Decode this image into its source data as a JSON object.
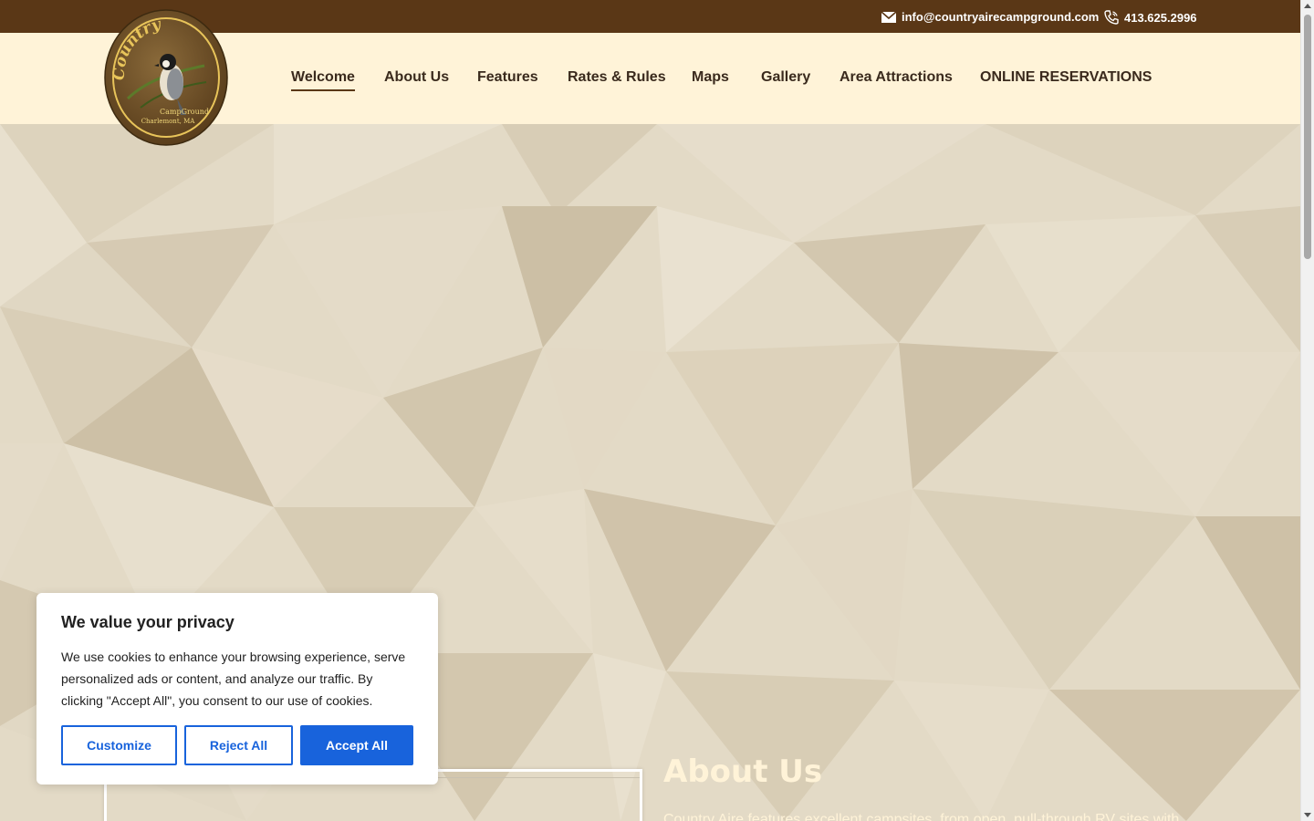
{
  "header": {
    "email": "info@countryairecampground.com",
    "phone": "413.625.2996"
  },
  "logo": {
    "line1": "Country Aire",
    "line2": "CampGround",
    "line3": "Charlemont, MA"
  },
  "nav": {
    "items": [
      {
        "label": "Welcome"
      },
      {
        "label": "About Us"
      },
      {
        "label": "Features"
      },
      {
        "label": "Rates & Rules"
      },
      {
        "label": "Maps"
      },
      {
        "label": "Gallery"
      },
      {
        "label": "Area Attractions"
      },
      {
        "label": "ONLINE RESERVATIONS"
      }
    ],
    "active": "Welcome"
  },
  "about": {
    "heading": "About Us",
    "text": "Country Aire features excellent campsites, from open, pull-through RV sites with"
  },
  "cookie": {
    "title": "We value your privacy",
    "body": "We use cookies to enhance your browsing experience, serve personalized ads or content, and analyze our traffic. By clicking \"Accept All\", you consent to our use of cookies.",
    "customize_label": "Customize",
    "reject_label": "Reject All",
    "accept_label": "Accept All"
  },
  "colors": {
    "topbar": "#5a3716",
    "navbar": "#fff3d8",
    "accent": "#1863dc",
    "background": "#e3dac6"
  }
}
